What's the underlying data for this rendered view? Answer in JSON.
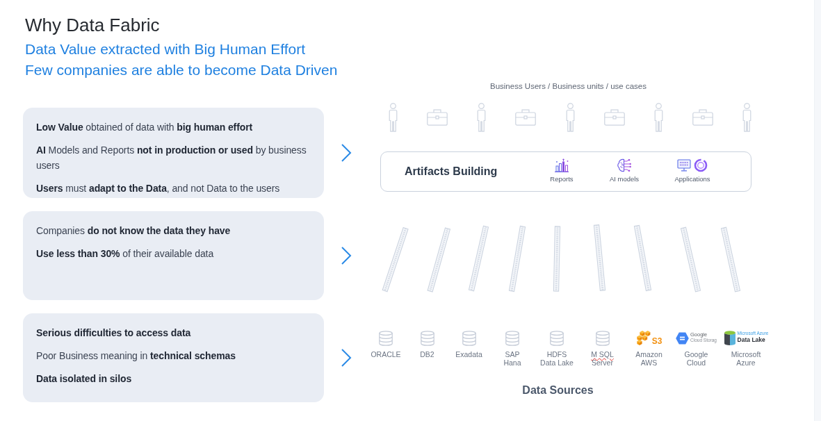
{
  "title": "Why Data Fabric",
  "subtitles": [
    "Data Value extracted with Big Human Effort",
    "Few companies are able to become Data Driven"
  ],
  "cards": [
    {
      "paragraphs": [
        {
          "text": "**Low Value** obtained of data with **big human effort**",
          "bold": false
        },
        {
          "text": "**AI** Models and Reports **not in production or used** by business users",
          "bold": false
        },
        {
          "text": "**Users** must **adapt to the Data**, and not Data to the users",
          "bold": false
        }
      ]
    },
    {
      "paragraphs": [
        {
          "text": "Companies **do not know the data they have**",
          "bold": false
        },
        {
          "text": "**Use less than 30%** of their available data",
          "bold": false
        }
      ]
    },
    {
      "paragraphs": [
        {
          "text": "Serious difficulties to access data",
          "bold": true
        },
        {
          "text": "Poor Business meaning in **technical schemas**",
          "bold": false
        },
        {
          "text": "Data isolated in silos",
          "bold": true
        }
      ]
    }
  ],
  "users_caption": "Business Users / Business units / use cases",
  "user_icons": [
    {
      "kind": "person"
    },
    {
      "kind": "briefcase"
    },
    {
      "kind": "person"
    },
    {
      "kind": "briefcase"
    },
    {
      "kind": "person"
    },
    {
      "kind": "briefcase"
    },
    {
      "kind": "person"
    },
    {
      "kind": "briefcase"
    },
    {
      "kind": "person"
    }
  ],
  "artifacts": {
    "title": "Artifacts Building",
    "items": [
      {
        "kind": "reports",
        "label": "Reports"
      },
      {
        "kind": "ai-models",
        "label": "AI models"
      },
      {
        "kind": "applications",
        "label": "Applications"
      }
    ]
  },
  "sources": [
    {
      "kind": "database",
      "lines": [
        "ORACLE"
      ],
      "spelling_flagged": false
    },
    {
      "kind": "database",
      "lines": [
        "DB2"
      ],
      "spelling_flagged": false
    },
    {
      "kind": "database",
      "lines": [
        "Exadata"
      ],
      "spelling_flagged": false
    },
    {
      "kind": "database",
      "lines": [
        "SAP",
        "Hana"
      ],
      "spelling_flagged": false
    },
    {
      "kind": "database",
      "lines": [
        "HDFS",
        "Data Lake"
      ],
      "spelling_flagged": false
    },
    {
      "kind": "database",
      "lines": [
        "M SQL",
        "Server"
      ],
      "spelling_flagged": true
    },
    {
      "kind": "s3",
      "logo_text": [
        "S3"
      ],
      "lines": [
        "Amazon",
        "AWS"
      ],
      "spelling_flagged": false
    },
    {
      "kind": "cloud-storage",
      "logo_text": [
        "Google",
        "Cloud Storag"
      ],
      "lines": [
        "Google",
        "Cloud"
      ],
      "spelling_flagged": false
    },
    {
      "kind": "data-lake",
      "logo_text": [
        "Microsoft Azure",
        "Data Lake"
      ],
      "lines": [
        "Microsoft",
        "Azure"
      ],
      "spelling_flagged": false
    }
  ],
  "sources_title": "Data Sources"
}
